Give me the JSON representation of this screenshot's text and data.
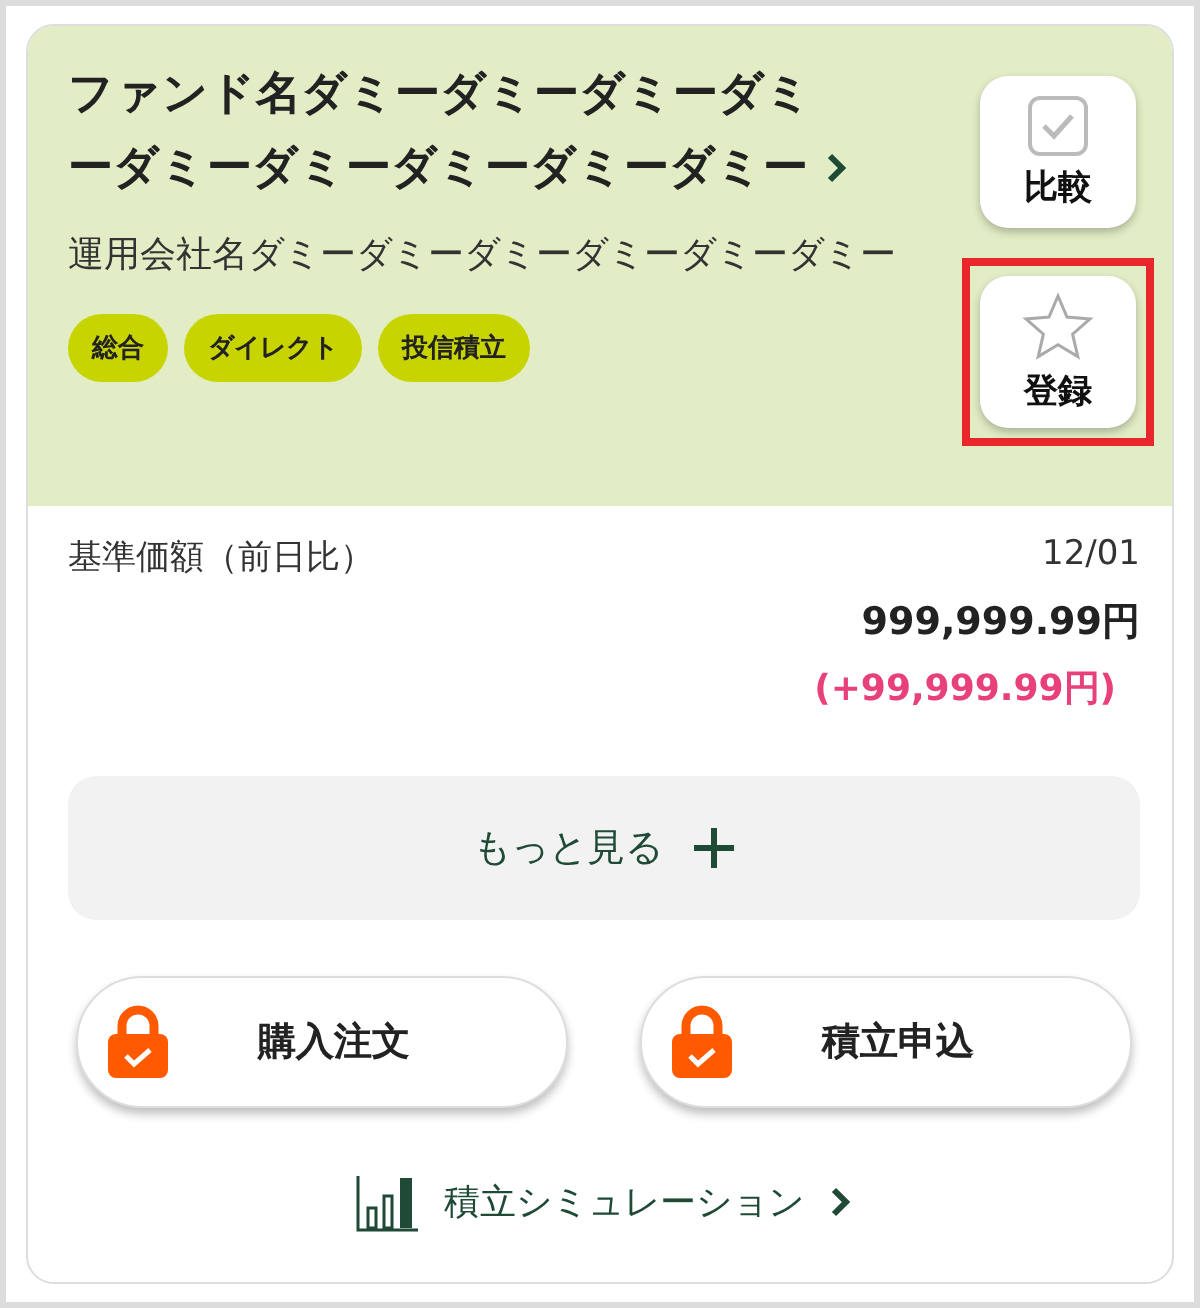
{
  "fund": {
    "name": "ファンド名ダミーダミーダミーダミーダミーダミーダミーダミーダミー",
    "company": "運用会社名ダミーダミーダミーダミーダミーダミー",
    "tags": [
      "総合",
      "ダイレクト",
      "投信積立"
    ]
  },
  "side_buttons": [
    {
      "kind": "compare",
      "label": "比較",
      "checked": false,
      "highlighted": false
    },
    {
      "kind": "favorite",
      "label": "登録",
      "highlighted": true
    }
  ],
  "price": {
    "label": "基準価額（前日比）",
    "date": "12/01",
    "value": "999,999.99円",
    "change": "(+99,999.99円)"
  },
  "more_button": {
    "label": "もっと見る"
  },
  "order_buttons": [
    {
      "label": "購入注文",
      "locked": true
    },
    {
      "label": "積立申込",
      "locked": true
    }
  ],
  "simulation_link": {
    "label": "積立シミュレーション"
  }
}
